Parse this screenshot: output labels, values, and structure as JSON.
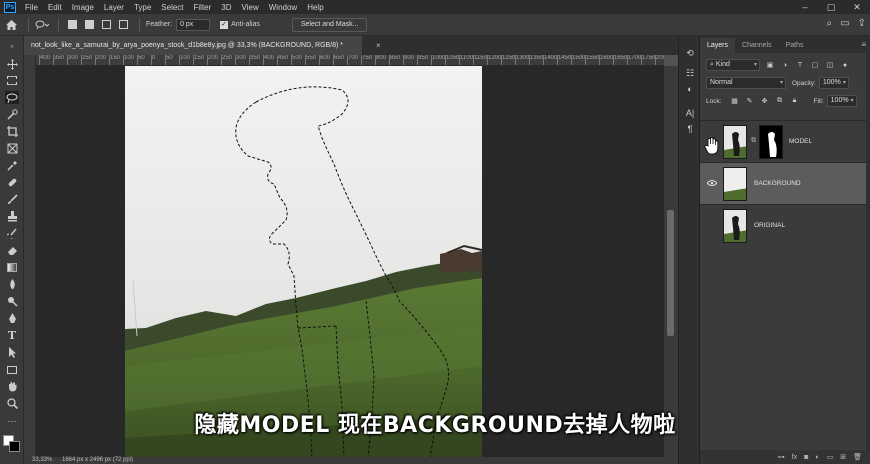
{
  "app": {
    "logo_text": "Ps"
  },
  "menubar": {
    "items": [
      "File",
      "Edit",
      "Image",
      "Layer",
      "Type",
      "Select",
      "Filter",
      "3D",
      "View",
      "Window",
      "Help"
    ]
  },
  "options_bar": {
    "feather_label": "Feather:",
    "feather_value": "0 px",
    "antialias_label": "Anti-alias",
    "antialias_checked": true,
    "select_mask_label": "Select and Mask..."
  },
  "document": {
    "tab_title": "not_look_like_a_samurai_by_arya_poenya_stock_d1b8e8y.jpg @ 33,3% (BACKGROUND, RGB/8) *",
    "tab_close": "×",
    "ruler_ticks": [
      "400",
      "350",
      "300",
      "250",
      "200",
      "150",
      "100",
      "50",
      "0",
      "50",
      "100",
      "150",
      "200",
      "250",
      "300",
      "350",
      "400",
      "450",
      "500",
      "550",
      "600",
      "650",
      "700",
      "750",
      "800",
      "850",
      "900",
      "950",
      "1000",
      "1050",
      "1100",
      "1150",
      "1200",
      "1250",
      "1300",
      "1350",
      "1400",
      "1450",
      "1500",
      "1550",
      "1600",
      "1650",
      "1700",
      "1750",
      "2000",
      "2050"
    ]
  },
  "status_bar": {
    "zoom": "33,33%",
    "doc_info": "1664 px x 2496 px (72 ppi)"
  },
  "layers_panel": {
    "tabs": [
      "Layers",
      "Channels",
      "Paths"
    ],
    "active_tab": "Layers",
    "filter_kind": "Kind",
    "blend_mode": "Normal",
    "opacity_label": "Opacity:",
    "opacity_value": "100%",
    "lock_label": "Lock:",
    "fill_label": "Fill:",
    "fill_value": "100%",
    "layers": [
      {
        "name": "MODEL",
        "visible": false,
        "selected": false,
        "has_mask": true
      },
      {
        "name": "BACKGROUND",
        "visible": true,
        "selected": true,
        "has_mask": false
      },
      {
        "name": "ORIGINAL",
        "visible": false,
        "selected": false,
        "has_mask": false
      }
    ]
  },
  "subtitle": "隐藏MODEL 现在BACKGROUND去掉人物啦",
  "colors": {
    "foreground": "#ffffff",
    "background": "#000000",
    "accent": "#31a8ff"
  }
}
